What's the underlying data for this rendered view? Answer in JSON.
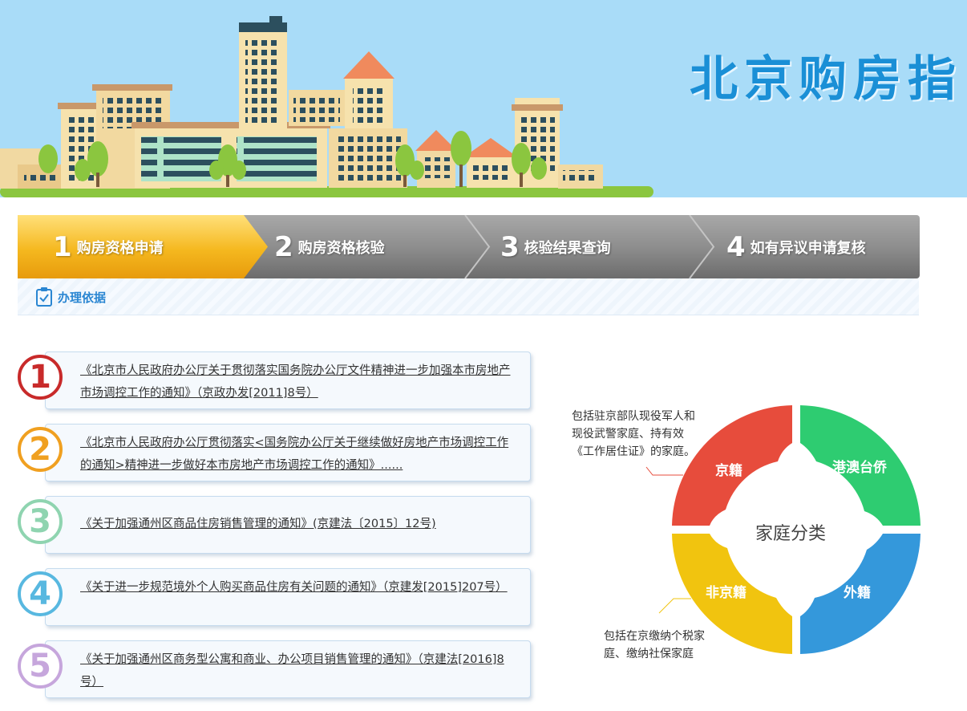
{
  "banner": {
    "title": "北京购房指"
  },
  "steps": [
    {
      "num": "1",
      "label": "购房资格申请",
      "active": true
    },
    {
      "num": "2",
      "label": "购房资格核验",
      "active": false
    },
    {
      "num": "3",
      "label": "核验结果查询",
      "active": false
    },
    {
      "num": "4",
      "label": "如有异议申请复核",
      "active": false
    }
  ],
  "basis": {
    "label": "办理依据"
  },
  "notices": [
    {
      "num": "1",
      "color": "#c82a2a",
      "text": "《北京市人民政府办公厅关于贯彻落实国务院办公厅文件精神进一步加强本市房地产市场调控工作的通知》（京政办发[2011]8号）"
    },
    {
      "num": "2",
      "color": "#f0a020",
      "text": "《北京市人民政府办公厅贯彻落实<国务院办公厅关于继续做好房地产市场调控工作的通知>精神进一步做好本市房地产市场调控工作的通知》......"
    },
    {
      "num": "3",
      "color": "#8fd4b0",
      "text": "《关于加强通州区商品住房销售管理的通知》(京建法〔2015〕12号)"
    },
    {
      "num": "4",
      "color": "#58b8e0",
      "text": "《关于进一步规范境外个人购买商品住房有关问题的通知》（京建发[2015]207号）"
    },
    {
      "num": "5",
      "color": "#c6a6dc",
      "text": "《关于加强通州区商务型公寓和商业、办公项目销售管理的通知》（京建法[2016]8号）"
    }
  ],
  "family": {
    "center": "家庭分类",
    "segments": [
      {
        "label": "京籍",
        "color": "#e74c3c"
      },
      {
        "label": "港澳台侨",
        "color": "#2ecc71"
      },
      {
        "label": "外籍",
        "color": "#3498db"
      },
      {
        "label": "非京籍",
        "color": "#f1c40f"
      }
    ],
    "annotation_top": "包括驻京部队现役军人和现役武警家庭、持有效《工作居住证》的家庭。",
    "annotation_bottom": "包括在京缴纳个税家庭、缴纳社保家庭"
  }
}
